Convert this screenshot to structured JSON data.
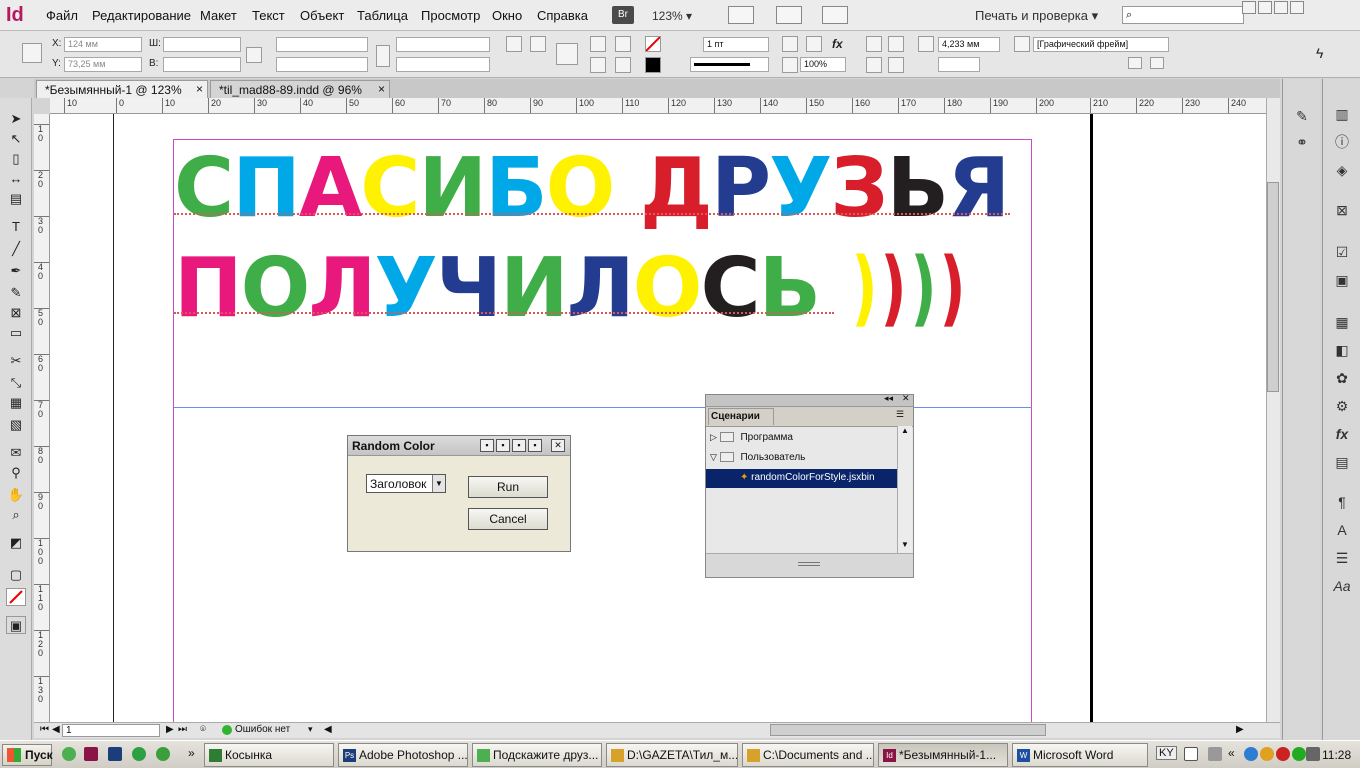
{
  "app": {
    "logo": "Id"
  },
  "menu": [
    "Файл",
    "Редактирование",
    "Макет",
    "Текст",
    "Объект",
    "Таблица",
    "Просмотр",
    "Окно",
    "Справка"
  ],
  "menubar": {
    "bridge": "Br",
    "zoom": "123%",
    "workspace": "Печать и проверка"
  },
  "control": {
    "x_label": "X:",
    "x_val": "124 мм",
    "y_label": "Y:",
    "y_val": "73,25 мм",
    "w_label": "Ш:",
    "h_label": "В:",
    "stroke_weight": "1 пт",
    "opacity": "100%",
    "offset": "4,233 мм",
    "frame_style": "[Графический фрейм]",
    "fx": "fx"
  },
  "tabs": [
    {
      "label": "*Безымянный-1 @ 123%",
      "close": "×"
    },
    {
      "label": "*til_mad88-89.indd @ 96%",
      "close": "×"
    }
  ],
  "ruler_top": [
    "10",
    "0",
    "10",
    "20",
    "30",
    "40",
    "50",
    "60",
    "70",
    "80",
    "90",
    "100",
    "110",
    "120",
    "130",
    "140",
    "150",
    "160",
    "170",
    "180",
    "190",
    "200",
    "210",
    "220",
    "230",
    "240"
  ],
  "ruler_left": [
    "1\n0",
    "2\n0",
    "3\n0",
    "4\n0",
    "5\n0",
    "6\n0",
    "7\n0",
    "8\n0",
    "9\n0",
    "1\n0\n0",
    "1\n1\n0",
    "1\n2\n0",
    "1\n3\n0"
  ],
  "headline1": {
    "letters": [
      "С",
      "П",
      "А",
      "С",
      "И",
      "Б",
      "О",
      " ",
      "Д",
      "Р",
      "У",
      "З",
      "Ь",
      "Я"
    ],
    "colors": [
      "#3fae48",
      "#00a8e8",
      "#e8187c",
      "#fff200",
      "#3fae48",
      "#00a8e8",
      "#fff200",
      "#ffffff",
      "#d81e2a",
      "#233c8f",
      "#00a8e8",
      "#d81e2a",
      "#231f20",
      "#233c8f"
    ]
  },
  "headline2": {
    "letters": [
      "П",
      "О",
      "Л",
      "У",
      "Ч",
      "И",
      "Л",
      "О",
      "С",
      "Ь",
      " ",
      ")",
      ")",
      ")",
      ")"
    ],
    "colors": [
      "#e8187c",
      "#3fae48",
      "#e8187c",
      "#00a8e8",
      "#233c8f",
      "#3fae48",
      "#233c8f",
      "#fff200",
      "#231f20",
      "#3fae48",
      "#ffffff",
      "#fff200",
      "#d81e2a",
      "#3fae48",
      "#d81e2a"
    ]
  },
  "dialog": {
    "title": "Random Color",
    "select": "Заголовок",
    "run": "Run",
    "cancel": "Cancel"
  },
  "scripts_panel": {
    "tab": "Сценарии",
    "folder1": "Программа",
    "folder2": "Пользователь",
    "file": "randomColorForStyle.jsxbin"
  },
  "status": {
    "page": "1",
    "errors": "Ошибок нет"
  },
  "taskbar": {
    "start": "Пуск",
    "items": [
      {
        "label": "Косынка",
        "icon": "cards-icon",
        "color": "#2e7d32"
      },
      {
        "label": "Adobe Photoshop ...",
        "icon": "Ps",
        "color": "#1b3e7a"
      },
      {
        "label": "Подскажите друз...",
        "icon": "web-icon",
        "color": "#4caf50"
      },
      {
        "label": "D:\\GAZETA\\Тил_м...",
        "icon": "folder-icon",
        "color": "#d8a22a"
      },
      {
        "label": "C:\\Documents and ...",
        "icon": "folder-icon",
        "color": "#d8a22a"
      },
      {
        "label": "*Безымянный-1...",
        "icon": "Id",
        "color": "#8b1446"
      },
      {
        "label": "Microsoft Word",
        "icon": "W",
        "color": "#1e4fa0"
      }
    ],
    "lang": "KY",
    "clock": "11:28"
  }
}
